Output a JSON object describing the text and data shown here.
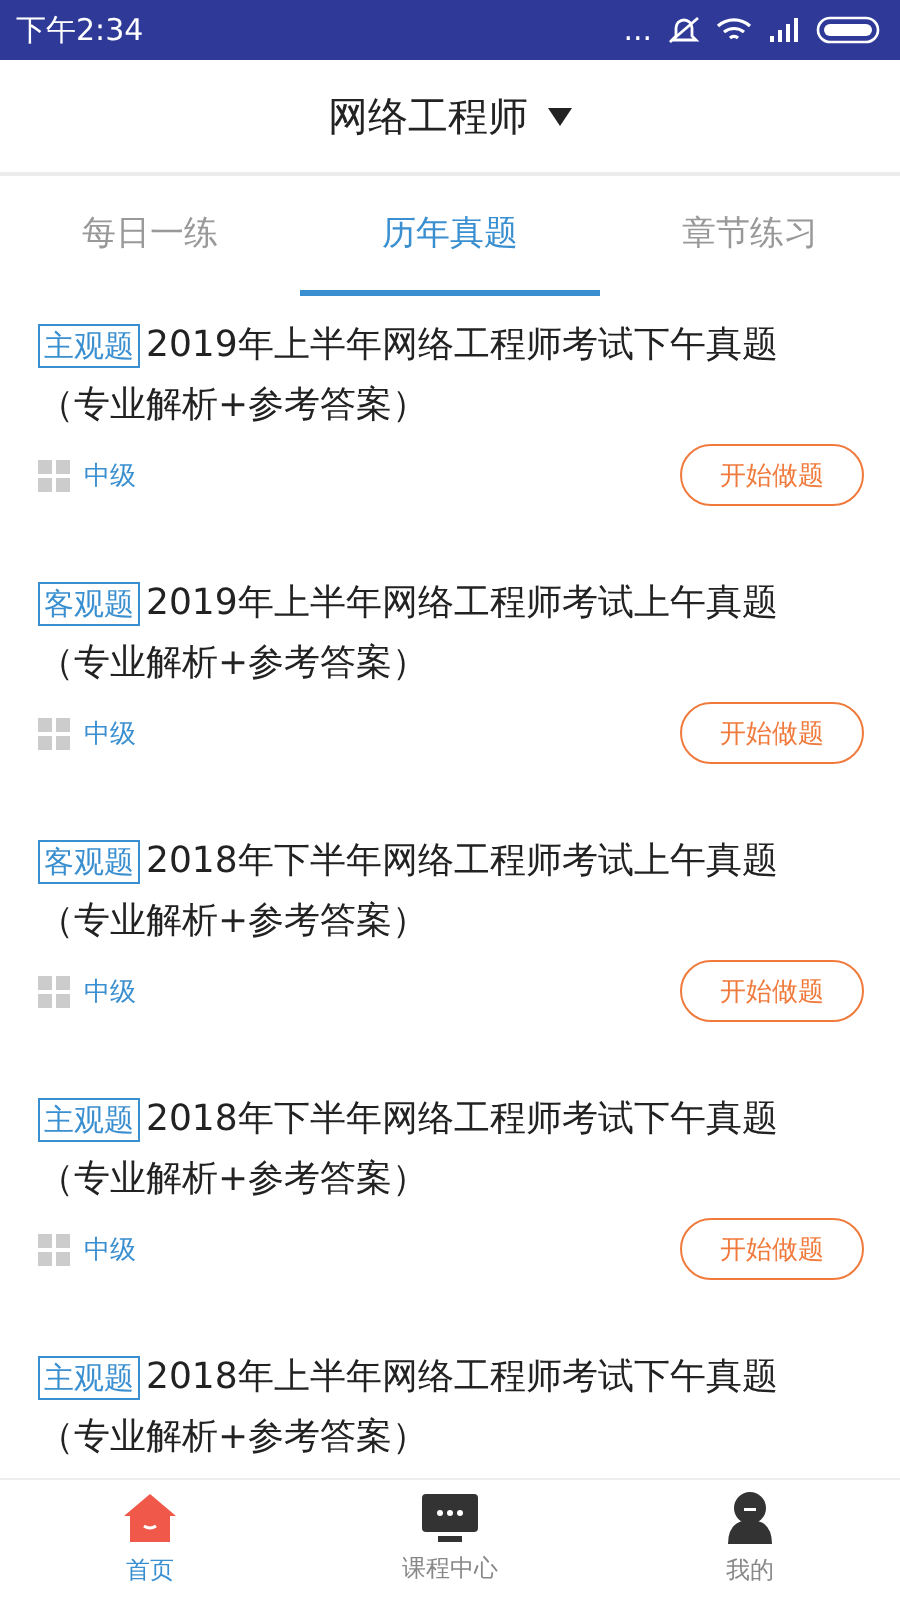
{
  "status_bar": {
    "time": "下午2:34",
    "dots": "..."
  },
  "header": {
    "title": "网络工程师"
  },
  "tabs": [
    {
      "label": "每日一练",
      "selected": false
    },
    {
      "label": "历年真题",
      "selected": true
    },
    {
      "label": "章节练习",
      "selected": false
    }
  ],
  "items": [
    {
      "tag": "主观题",
      "title": "2019年上半年网络工程师考试下午真题",
      "subtitle": "（专业解析+参考答案）",
      "level": "中级",
      "button": "开始做题"
    },
    {
      "tag": "客观题",
      "title": "2019年上半年网络工程师考试上午真题",
      "subtitle": "（专业解析+参考答案）",
      "level": "中级",
      "button": "开始做题"
    },
    {
      "tag": "客观题",
      "title": "2018年下半年网络工程师考试上午真题",
      "subtitle": "（专业解析+参考答案）",
      "level": "中级",
      "button": "开始做题"
    },
    {
      "tag": "主观题",
      "title": "2018年下半年网络工程师考试下午真题",
      "subtitle": "（专业解析+参考答案）",
      "level": "中级",
      "button": "开始做题"
    },
    {
      "tag": "主观题",
      "title": "2018年上半年网络工程师考试下午真题",
      "subtitle": "（专业解析+参考答案）"
    }
  ],
  "bottom_nav": [
    {
      "kind": "home",
      "label": "首页",
      "selected": true
    },
    {
      "kind": "tv",
      "label": "课程中心",
      "selected": false
    },
    {
      "kind": "person",
      "label": "我的",
      "selected": false
    }
  ]
}
